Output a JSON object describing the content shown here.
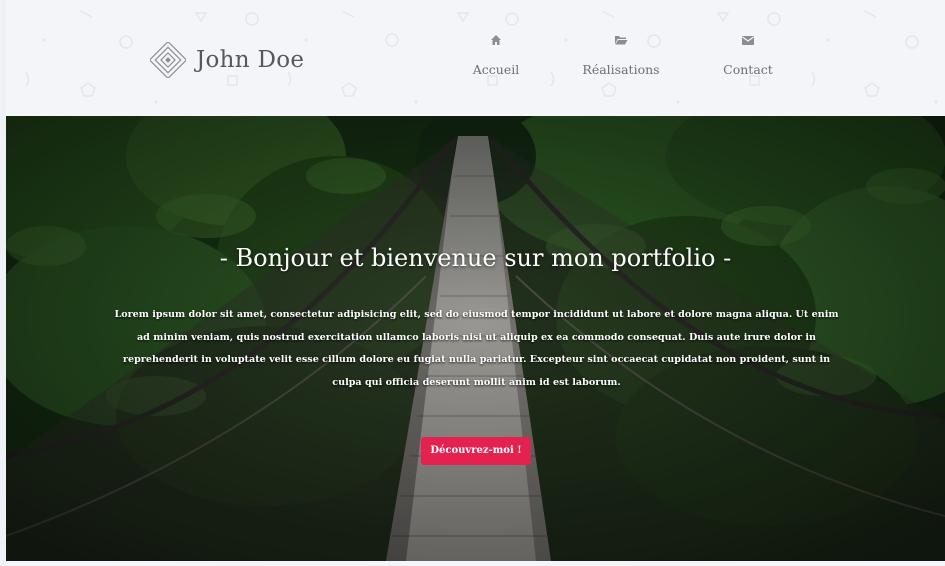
{
  "brand": {
    "name": "John Doe",
    "logo_icon": "diamond-logo-icon"
  },
  "nav": {
    "items": [
      {
        "label": "Accueil",
        "icon": "home-icon"
      },
      {
        "label": "Réalisations",
        "icon": "folder-icon"
      },
      {
        "label": "Contact",
        "icon": "envelope-icon"
      }
    ]
  },
  "hero": {
    "title": "- Bonjour et bienvenue sur mon portfolio -",
    "text": "Lorem ipsum dolor sit amet, consectetur adipisicing elit, sed do eiusmod tempor incididunt ut labore et dolore magna aliqua. Ut enim ad minim veniam, quis nostrud exercitation ullamco laboris nisi ut aliquip ex ea commodo consequat. Duis aute irure dolor in reprehenderit in voluptate velit esse cillum dolore eu fugiat nulla pariatur. Excepteur sint occaecat cupidatat non proident, sunt in culpa qui officia deserunt mollit anim id est laborum.",
    "cta_label": "Découvrez-moi !"
  },
  "colors": {
    "accent": "#e4214f",
    "header_bg": "#f4f5f8",
    "nav_text": "#6b6f75",
    "foliage": "#2c5a22"
  }
}
